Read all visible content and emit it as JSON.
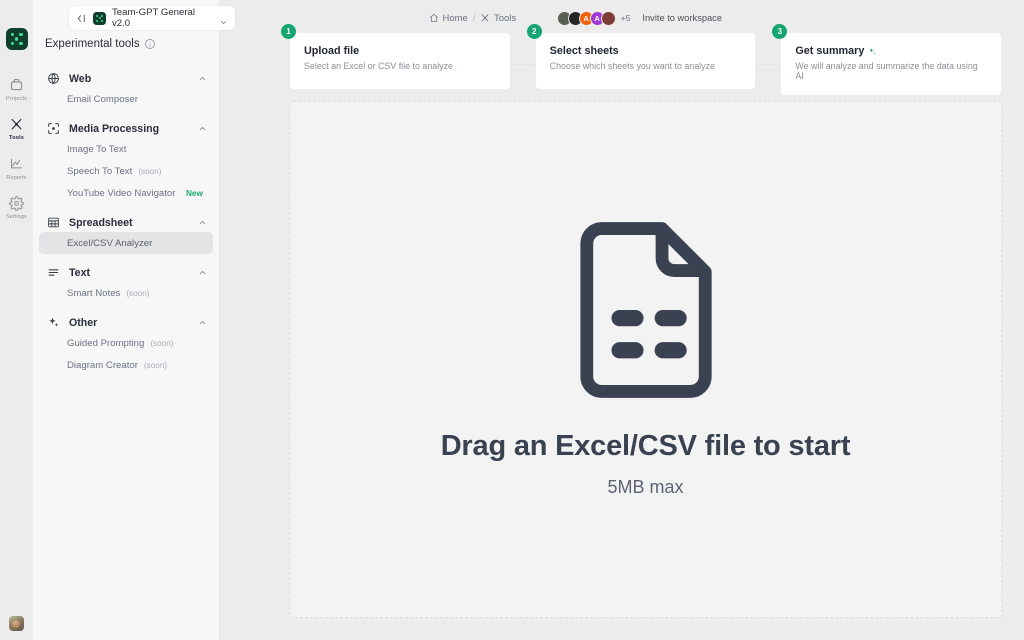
{
  "rail": {
    "logo_name": "team-gpt-logo",
    "items": [
      {
        "label": "Projects",
        "icon": "projects-icon",
        "active": false
      },
      {
        "label": "Tools",
        "icon": "tools-icon",
        "active": true
      },
      {
        "label": "Reports",
        "icon": "reports-icon",
        "active": false
      },
      {
        "label": "Settings",
        "icon": "settings-icon",
        "active": false
      }
    ],
    "avatar_name": "user-avatar"
  },
  "topbar": {
    "collapse_icon": "collapse-sidebar-icon",
    "workspace_name": "Team-GPT General v2.0",
    "workspace_chevron": "chevron-down-icon",
    "breadcrumb": [
      {
        "label": "Home",
        "icon": "home-icon"
      },
      {
        "label": "Tools",
        "icon": "tools-icon"
      }
    ],
    "breadcrumb_separator": "/",
    "avatars": [
      {
        "type": "photo",
        "color": "#5b5f52",
        "initial": ""
      },
      {
        "type": "photo",
        "color": "#2a2a2a",
        "initial": ""
      },
      {
        "type": "initial",
        "color": "#f2610c",
        "initial": "A"
      },
      {
        "type": "initial",
        "color": "#a239d6",
        "initial": "A"
      },
      {
        "type": "photo",
        "color": "#7d3b35",
        "initial": ""
      }
    ],
    "overflow_count": "+5",
    "invite_label": "Invite to workspace"
  },
  "sidebar": {
    "panel_title": "Experimental tools",
    "info_icon": "info-icon",
    "groups": [
      {
        "label": "Web",
        "icon": "globe-icon",
        "chevron": "chevron-up-icon",
        "items": [
          {
            "label": "Email Composer",
            "suffix": "",
            "badge": "",
            "selected": false
          }
        ]
      },
      {
        "label": "Media Processing",
        "icon": "scan-icon",
        "chevron": "chevron-up-icon",
        "items": [
          {
            "label": "Image To Text",
            "suffix": "",
            "badge": "",
            "selected": false
          },
          {
            "label": "Speech To Text",
            "suffix": "(soon)",
            "badge": "",
            "selected": false
          },
          {
            "label": "YouTube Video Navigator",
            "suffix": "",
            "badge": "New",
            "selected": false
          }
        ]
      },
      {
        "label": "Spreadsheet",
        "icon": "table-icon",
        "chevron": "chevron-up-icon",
        "items": [
          {
            "label": "Excel/CSV Analyzer",
            "suffix": "",
            "badge": "",
            "selected": true
          }
        ]
      },
      {
        "label": "Text",
        "icon": "lines-icon",
        "chevron": "chevron-up-icon",
        "items": [
          {
            "label": "Smart Notes",
            "suffix": "(soon)",
            "badge": "",
            "selected": false
          }
        ]
      },
      {
        "label": "Other",
        "icon": "sparkles-icon",
        "chevron": "chevron-up-icon",
        "items": [
          {
            "label": "Guided Prompting",
            "suffix": "(soon)",
            "badge": "",
            "selected": false
          },
          {
            "label": "Diagram Creator",
            "suffix": "(soon)",
            "badge": "",
            "selected": false
          }
        ]
      }
    ]
  },
  "steps": [
    {
      "number": "1",
      "title": "Upload file",
      "desc": "Select an Excel or CSV file to analyze",
      "sparkle": false
    },
    {
      "number": "2",
      "title": "Select sheets",
      "desc": "Choose which sheets you want to analyze",
      "sparkle": false
    },
    {
      "number": "3",
      "title": "Get summary",
      "desc": "We will analyze and summarize the data using AI",
      "sparkle": true
    }
  ],
  "dropzone": {
    "icon": "document-file-icon",
    "title": "Drag an Excel/CSV file to start",
    "subtitle": "5MB max"
  },
  "colors": {
    "accent_green": "#16a571",
    "badge_new": "#1fa971",
    "doc_icon": "#3a4252",
    "sidebar_bg": "#f7f7f8",
    "canvas_bg": "#ececec"
  }
}
